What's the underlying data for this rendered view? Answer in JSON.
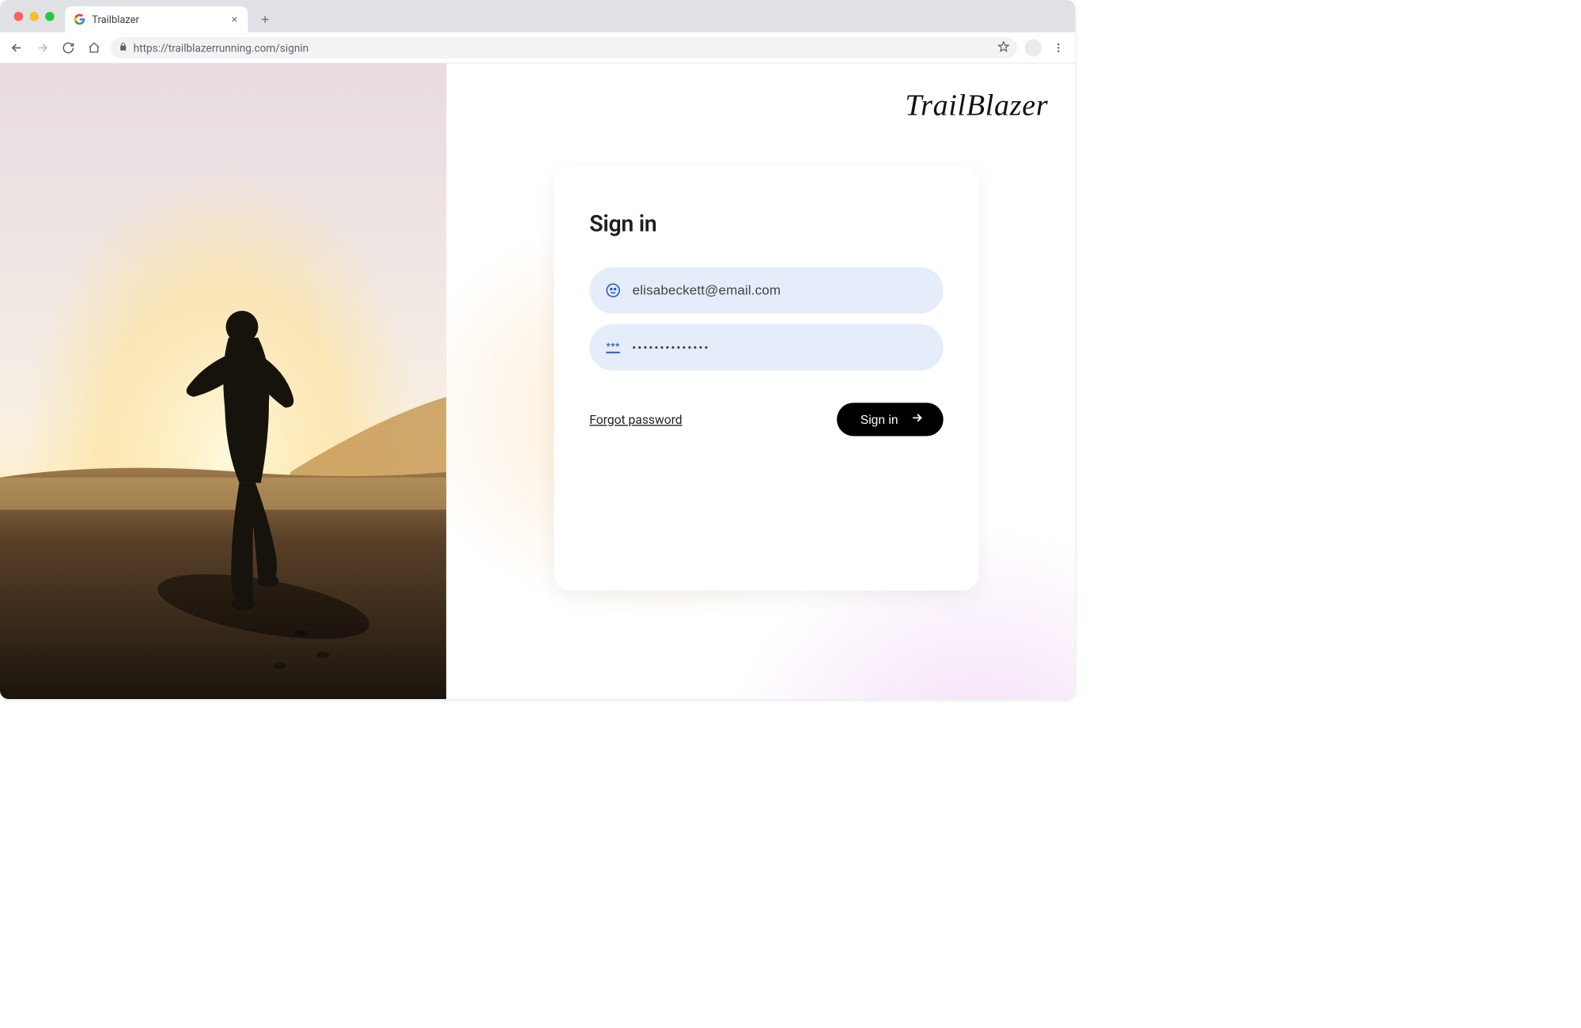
{
  "browser": {
    "tab_title": "Trailblazer",
    "url": "https://trailblazerrunning.com/signin"
  },
  "page": {
    "brand": "TrailBlazer",
    "signin_heading": "Sign in",
    "email_value": "elisabeckett@email.com",
    "password_value": "••••••••••••••",
    "forgot_label": "Forgot password",
    "signin_button_label": "Sign in"
  }
}
